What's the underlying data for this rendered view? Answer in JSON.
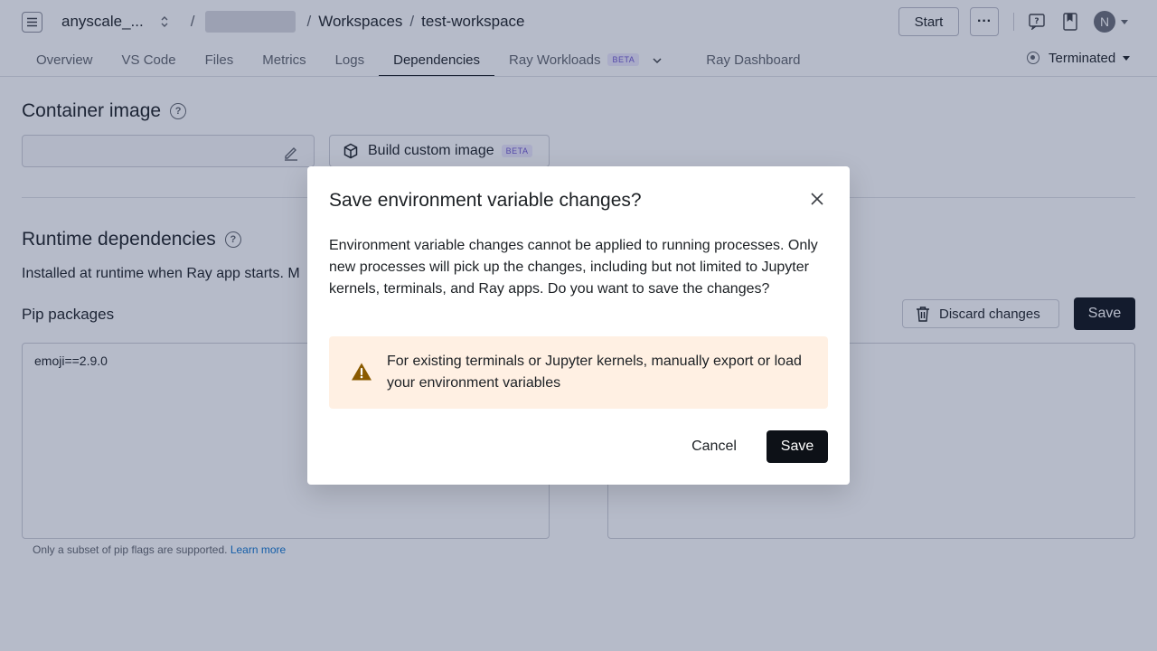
{
  "header": {
    "org": "anyscale_...",
    "separator": "/",
    "crumb_workspaces": "Workspaces",
    "crumb_workspace": "test-workspace",
    "start_label": "Start",
    "more_label": "···",
    "avatar_initial": "N"
  },
  "tabs": [
    {
      "label": "Overview"
    },
    {
      "label": "VS Code"
    },
    {
      "label": "Files"
    },
    {
      "label": "Metrics"
    },
    {
      "label": "Logs"
    },
    {
      "label": "Dependencies",
      "active": true
    },
    {
      "label": "Ray Workloads",
      "badge": "BETA"
    },
    {
      "label": "Ray Dashboard"
    }
  ],
  "status": {
    "label": "Terminated"
  },
  "container_image": {
    "title": "Container image",
    "build_label": "Build custom image",
    "build_badge": "BETA"
  },
  "runtime": {
    "title": "Runtime dependencies",
    "description": "Installed at runtime when Ray app starts. M",
    "pip_label": "Pip packages",
    "pip_value": "emoji==2.9.0",
    "pip_note": "Only a subset of pip flags are supported.",
    "pip_note_link": "Learn more",
    "discard_label": "Discard changes",
    "save_label": "Save"
  },
  "modal": {
    "title": "Save environment variable changes?",
    "body": "Environment variable changes cannot be applied to running processes. Only new processes will pick up the changes, including but not limited to Jupyter kernels, terminals, and Ray apps. Do you want to save the changes?",
    "warning": "For existing terminals or Jupyter kernels, manually export or load your environment variables",
    "cancel_label": "Cancel",
    "save_label": "Save"
  },
  "colors": {
    "primary_button": "#0d1117",
    "warning_bg": "#fff0e3",
    "warning_icon": "#8a5a00",
    "beta_badge": "#6e56cf",
    "link": "#0d74ce"
  }
}
